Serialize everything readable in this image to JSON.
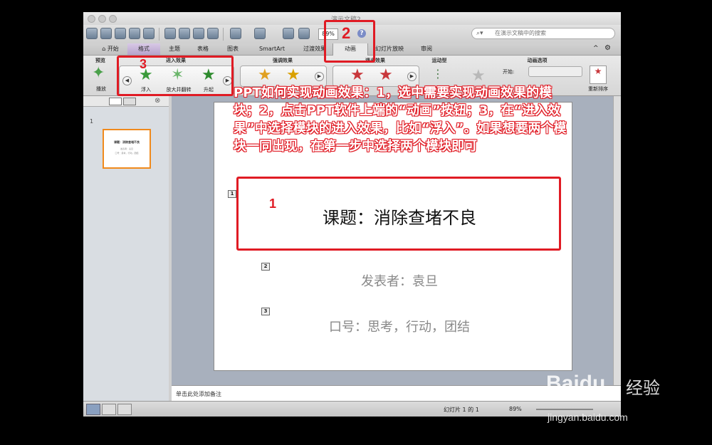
{
  "window": {
    "doc_title": "演示文稿2"
  },
  "toolbar": {
    "zoom": "89%",
    "help": "?",
    "search_placeholder": "在演示文稿中的搜索"
  },
  "tabs": [
    {
      "label": "开始"
    },
    {
      "label": "格式"
    },
    {
      "label": "主题"
    },
    {
      "label": "表格"
    },
    {
      "label": "图表"
    },
    {
      "label": "SmartArt"
    },
    {
      "label": "过渡效果"
    },
    {
      "label": "动画"
    },
    {
      "label": "幻灯片放映"
    },
    {
      "label": "审阅"
    }
  ],
  "ribbon": {
    "preview": {
      "group": "预览",
      "button": "播放"
    },
    "entrance": {
      "group": "进入效果",
      "effects": [
        "浮入",
        "放大并翻转",
        "升起"
      ]
    },
    "emphasis": {
      "group": "强调效果"
    },
    "exit": {
      "group": "退出效果"
    },
    "motion": {
      "group": "运动型"
    },
    "options": {
      "group": "动画选项",
      "start_label": "开始:",
      "reorder": "重新排序"
    }
  },
  "thumbnails": [
    {
      "number": "1",
      "title": "课题：消除查堵不良",
      "sub1": "发表者：袁旦",
      "sub2": "口号：思考，行动，团结"
    }
  ],
  "slide": {
    "title": "课题：消除查堵不良",
    "presenter": "发表者：袁旦",
    "slogan": "口号：思考，行动，团结",
    "tags": [
      "1",
      "2",
      "3"
    ]
  },
  "notes_placeholder": "单击此处添加备注",
  "status": {
    "slide_info": "幻灯片 1 的 1",
    "zoom": "89%"
  },
  "annotations": {
    "n1": "1",
    "n2": "2",
    "n3": "3",
    "instruction": "PPT如何实现动画效果：1，选中需要实现动画效果的模块；2，点击PPT软件上端的“动画”按钮；3，在“进入效果”中选择模块的进入效果，比如“浮入”。如果想要两个模块一同出现，在第一步中选择两个模块即可"
  },
  "watermark": {
    "brand": "Baidu",
    "product": "经验",
    "url": "jingyan.baidu.com"
  },
  "colors": {
    "annotation_red": "#e01b24",
    "format_tab": "#c6b3d8"
  },
  "icons": [
    "star-entrance-icon",
    "play-icon",
    "search-icon",
    "gear-icon",
    "close-icon"
  ]
}
